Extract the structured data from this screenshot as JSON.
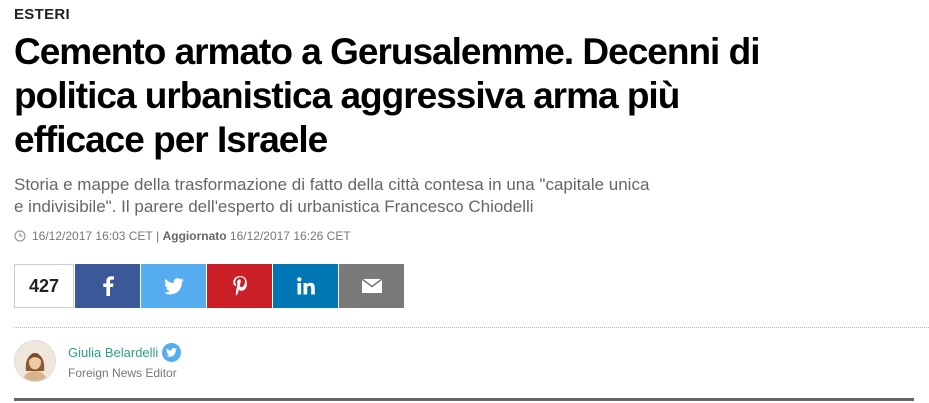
{
  "section": "ESTERI",
  "headline": "Cemento armato a Gerusalemme. Decenni di politica urbanistica aggressiva arma più efficace per Israele",
  "subtitle": "Storia e mappe della trasformazione di fatto della città contesa in una \"capitale unica e indivisibile\". Il parere dell'esperto di urbanistica Francesco Chiodelli",
  "meta": {
    "published": "16/12/2017 16:03 CET",
    "separator": "|",
    "updated_label": "Aggiornato",
    "updated": "16/12/2017 16:26 CET"
  },
  "share": {
    "count": "427",
    "buttons": [
      {
        "icon": "facebook-icon",
        "color": "#3b5998"
      },
      {
        "icon": "twitter-icon",
        "color": "#55acee"
      },
      {
        "icon": "pinterest-icon",
        "color": "#cb2027"
      },
      {
        "icon": "linkedin-icon",
        "color": "#0077b5"
      },
      {
        "icon": "email-icon",
        "color": "#7a7a7a"
      }
    ]
  },
  "author": {
    "name": "Giulia Belardelli",
    "role": "Foreign News Editor",
    "badge_icon": "twitter-icon"
  },
  "colors": {
    "author_name": "#2aa18a",
    "subtitle": "#666666"
  }
}
